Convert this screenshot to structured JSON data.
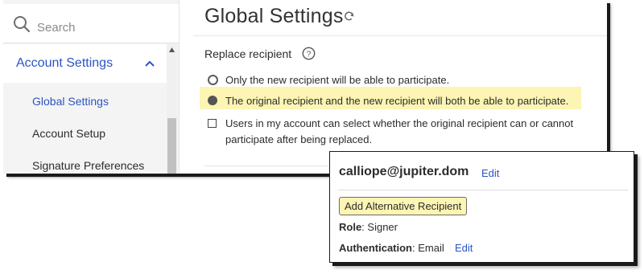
{
  "sidebar": {
    "search_placeholder": "Search",
    "section_label": "Account Settings",
    "items": [
      {
        "label": "Global Settings",
        "active": true
      },
      {
        "label": "Account Setup",
        "active": false
      },
      {
        "label": "Signature Preferences",
        "active": false
      }
    ]
  },
  "header": {
    "title": "Global Settings"
  },
  "replace_recipient": {
    "label": "Replace recipient",
    "options": [
      {
        "text": "Only the new recipient will be able to participate.",
        "control": "radio",
        "selected": false
      },
      {
        "text": "The original recipient and the new recipient will both be able to participate.",
        "control": "radio",
        "selected": true,
        "highlighted": true
      },
      {
        "text_line1": "Users in my account can select whether the original recipient can or cannot",
        "text_line2": "participate after being replaced.",
        "control": "checkbox",
        "checked": false
      }
    ]
  },
  "recipient_card": {
    "email": "calliope@jupiter.dom",
    "edit_label": "Edit",
    "add_alt_label": "Add Alternative Recipient",
    "role_label": "Role",
    "role_value": "Signer",
    "auth_label": "Authentication",
    "auth_value": "Email",
    "auth_edit_label": "Edit"
  },
  "colors": {
    "link": "#2b55c4",
    "highlight": "#fcf5b3"
  }
}
